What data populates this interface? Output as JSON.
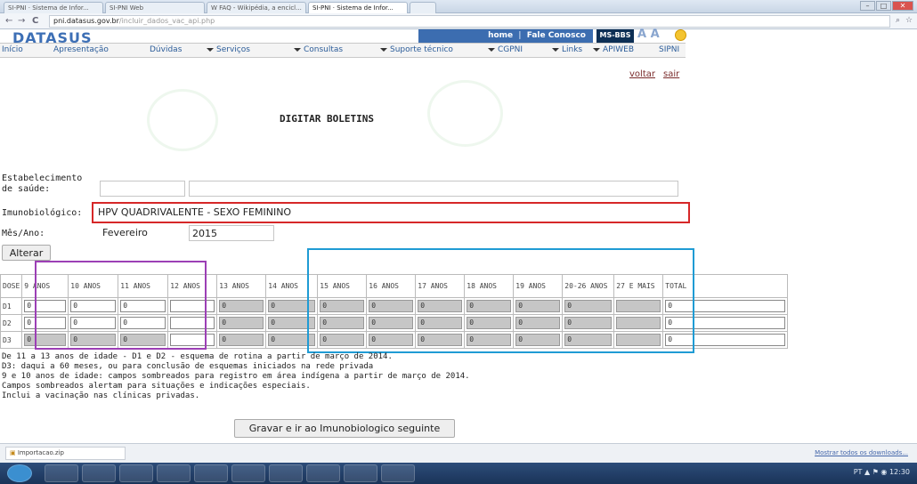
{
  "browser": {
    "tabs": [
      "SI-PNI · Sistema de Infor...",
      "SI-PNI Web",
      "W FAQ - Wikipédia, a encicl...",
      "SI-PNI · Sistema de Infor..."
    ],
    "url_host": "pni.datasus.gov.br",
    "url_path": "/incluir_dados_vac_api.php"
  },
  "site": {
    "logo": "DATASUS",
    "topnav": {
      "home": "home",
      "sep": "|",
      "contact": "Fale Conosco"
    },
    "msbbs": "MS-BBS",
    "font_size_ctrl": "A A"
  },
  "menu": [
    "Início",
    "Apresentação",
    "Dúvidas",
    "Serviços",
    "Consultas",
    "Suporte técnico",
    "CGPNI",
    "Links",
    "APIWEB",
    "SIPNI"
  ],
  "links": {
    "back": "voltar",
    "exit": "sair"
  },
  "page": {
    "title": "DIGITAR BOLETINS"
  },
  "form": {
    "estab_label": "Estabelecimento",
    "estab_label2": "de saúde:",
    "imuno_label": "Imunobiológico:",
    "imuno_value": "HPV QUADRIVALENTE - SEXO FEMININO",
    "mes_label": "Mês/Ano:",
    "mes_value": "Fevereiro",
    "ano_value": "2015",
    "alterar": "Alterar"
  },
  "table": {
    "headers": [
      "DOSE",
      "9 ANOS",
      "10 ANOS",
      "11 ANOS",
      "12 ANOS",
      "13 ANOS",
      "14 ANOS",
      "15 ANOS",
      "16 ANOS",
      "17 ANOS",
      "18 ANOS",
      "19 ANOS",
      "20-26 ANOS",
      "27 E MAIS",
      "TOTAL"
    ],
    "rows": [
      {
        "dose": "D1",
        "values": [
          "0",
          "0",
          "0",
          "",
          "0",
          "0",
          "0",
          "0",
          "0",
          "0",
          "0",
          "0",
          "",
          "0"
        ]
      },
      {
        "dose": "D2",
        "values": [
          "0",
          "0",
          "0",
          "",
          "0",
          "0",
          "0",
          "0",
          "0",
          "0",
          "0",
          "0",
          "",
          "0"
        ]
      },
      {
        "dose": "D3",
        "values": [
          "0",
          "0",
          "0",
          "",
          "0",
          "0",
          "0",
          "0",
          "0",
          "0",
          "0",
          "0",
          "",
          "0"
        ]
      }
    ]
  },
  "notes": [
    "De 11 a 13 anos de idade - D1 e D2 - esquema de rotina a partir de março de 2014.",
    "D3: daqui a 60 meses, ou para conclusão de esquemas iniciados na rede privada",
    "9 e 10 anos de idade: campos sombreados para registro em área indígena a partir de março de 2014.",
    "Campos sombreados alertam para situações e indicações especiais.",
    "Inclui a vacinação nas clínicas privadas."
  ],
  "submit": "Gravar e ir ao Imunobiologico seguinte",
  "downloads": {
    "item": "Importacao.zip",
    "show_all": "Mostrar todos os downloads..."
  },
  "tray": {
    "time": "12:30",
    "lang": "PT"
  },
  "colors": {
    "red_box": "#d62728",
    "purple_box": "#9c3fb5",
    "blue_box": "#1f9bd4",
    "brand": "#3c6db0"
  }
}
